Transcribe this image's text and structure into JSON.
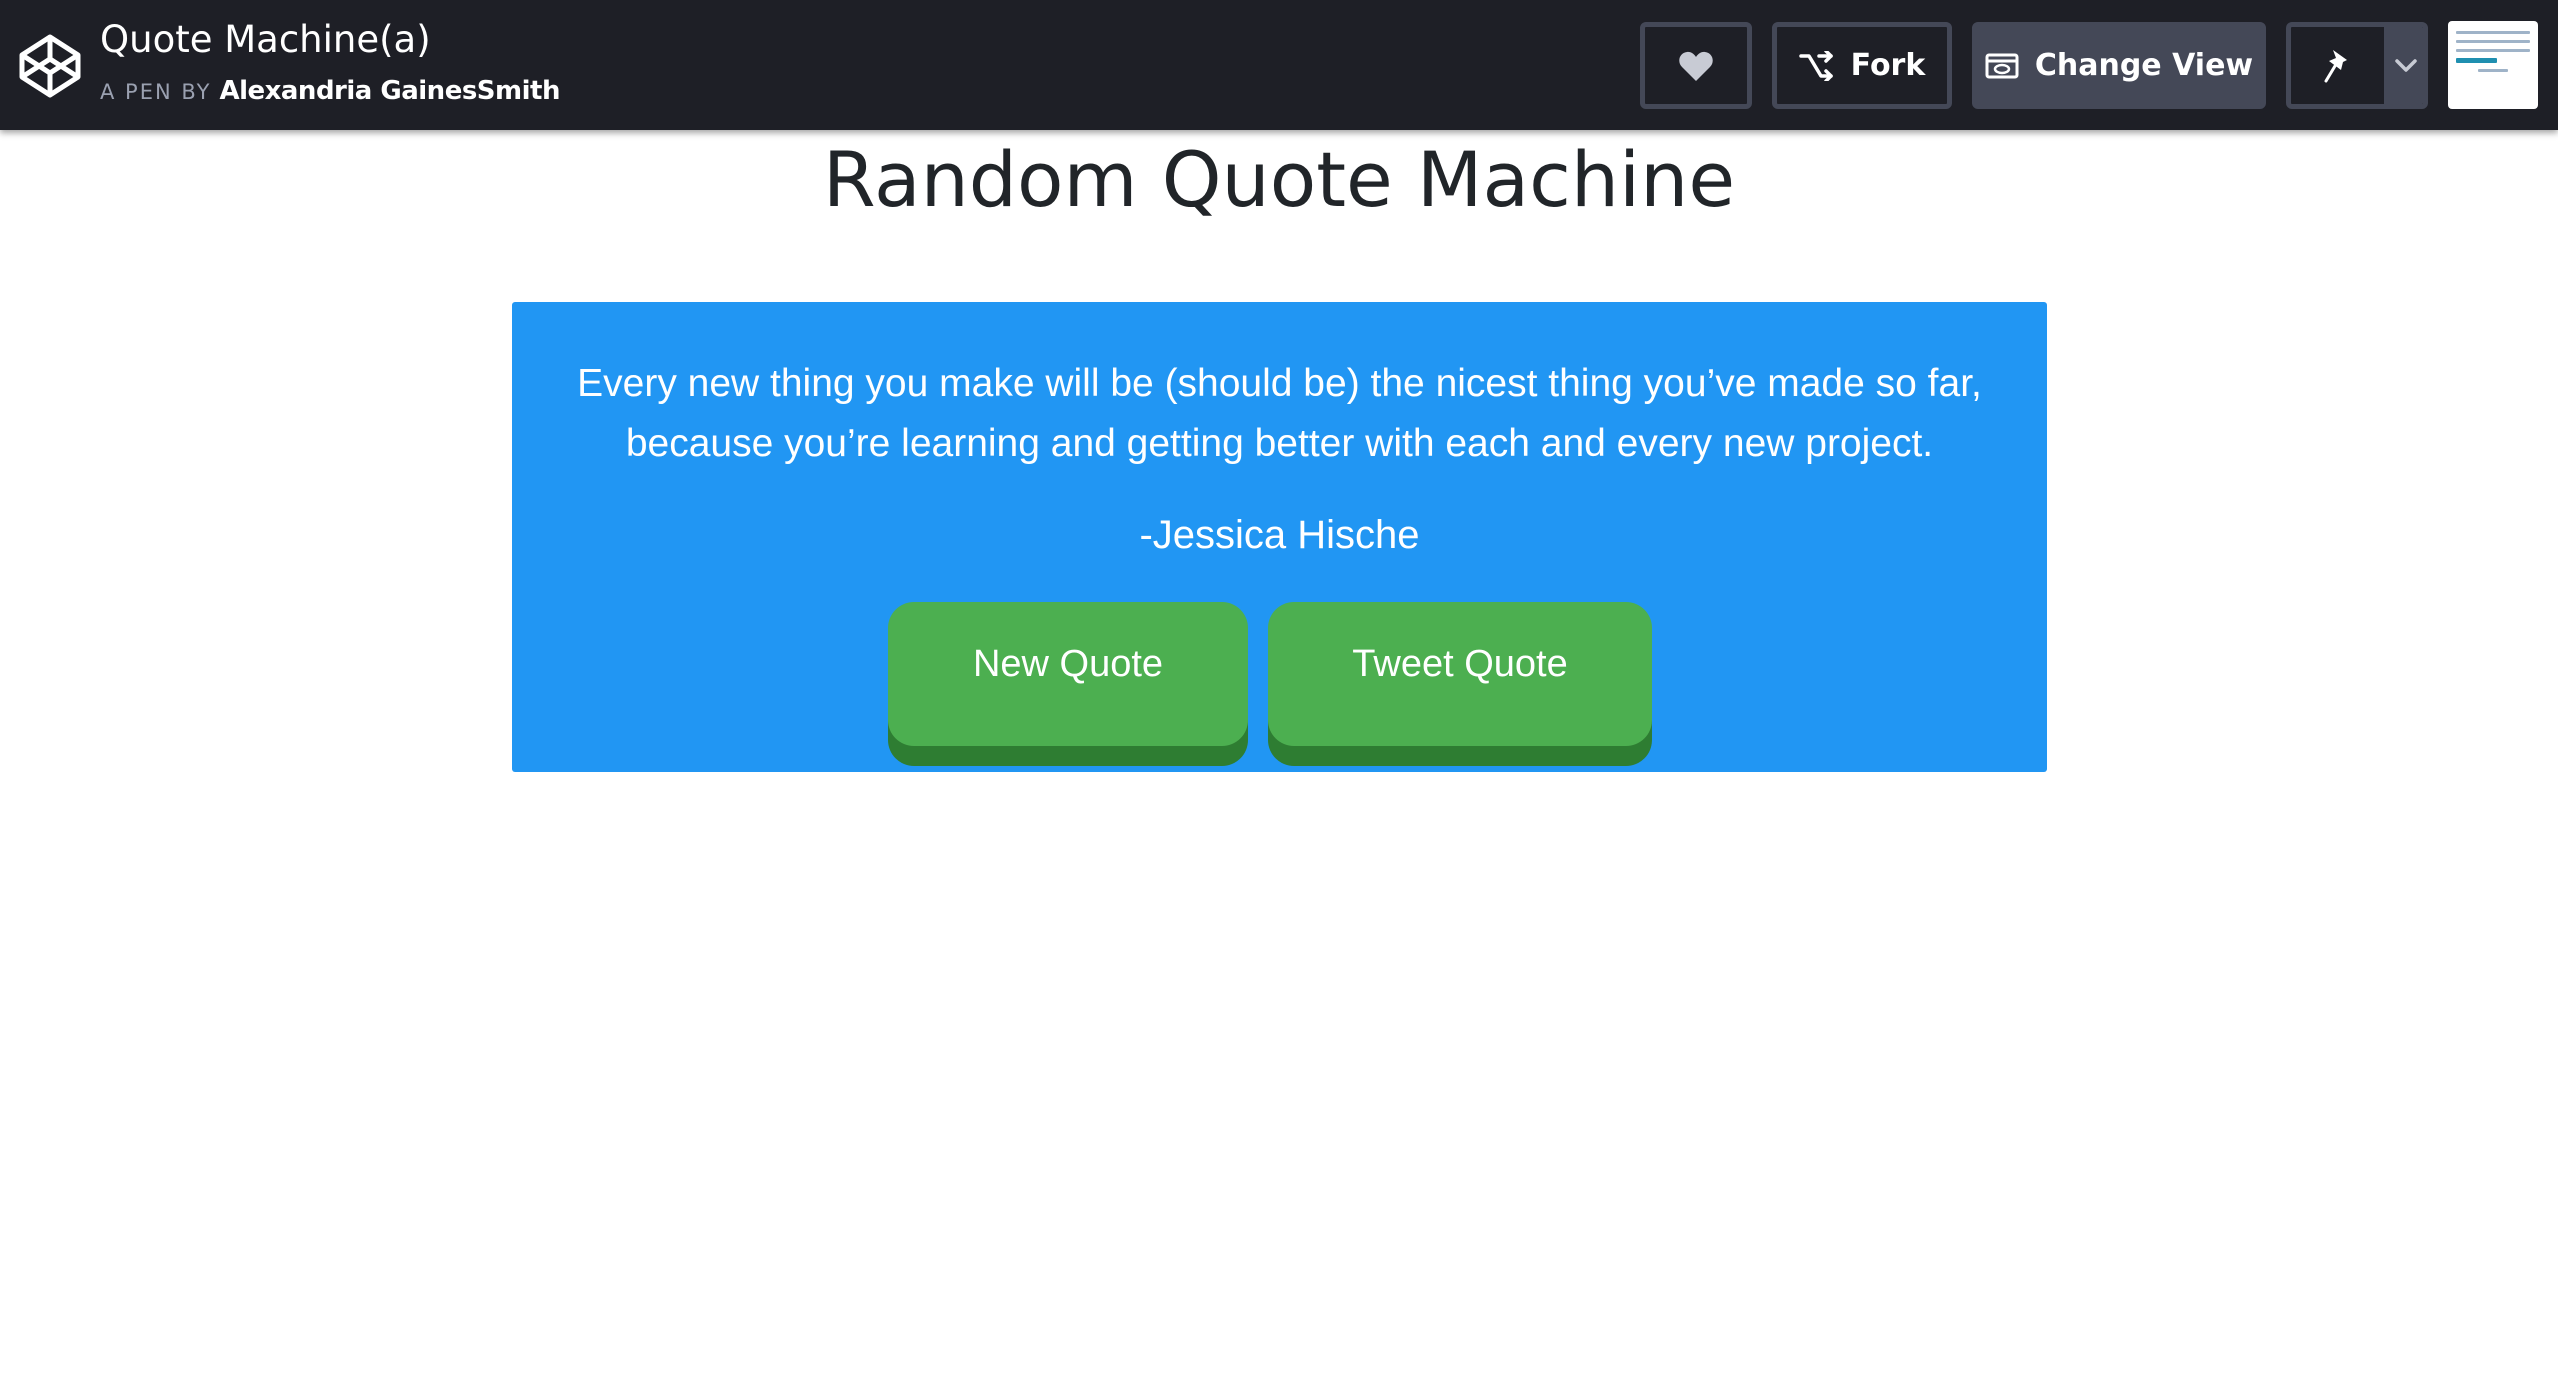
{
  "header": {
    "pen_title": "Quote Machine(a)",
    "pen_by_prefix": "A PEN BY",
    "author": "Alexandria GainesSmith",
    "buttons": {
      "heart_icon": "heart-icon",
      "fork_label": "Fork",
      "change_view_label": "Change View",
      "pin_icon": "pin-icon",
      "menu_icon": "chevron-down-icon"
    }
  },
  "main": {
    "title": "Random Quote Machine",
    "quote": {
      "text": "Every new thing you make will be (should be) the nicest thing you’ve made so far, because you’re learning and getting better with each and every new project.",
      "author": "-Jessica Hische"
    },
    "buttons": {
      "new_quote": "New Quote",
      "tweet_quote": "Tweet Quote"
    }
  },
  "colors": {
    "topbar": "#1e1f26",
    "quote_box": "#2196f3",
    "button": "#4caf50",
    "button_shadow": "#2e7d32"
  }
}
